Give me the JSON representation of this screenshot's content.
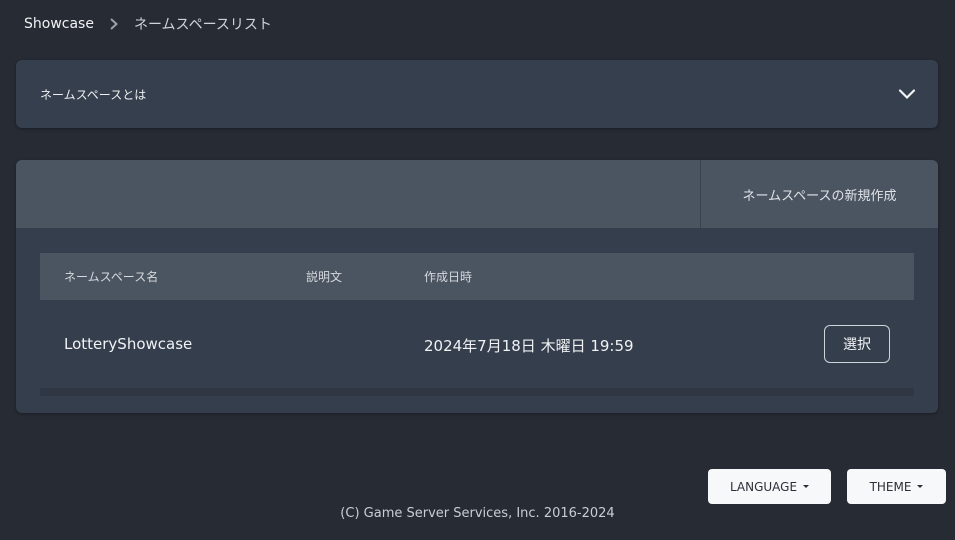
{
  "breadcrumb": {
    "root": "Showcase",
    "current": "ネームスペースリスト"
  },
  "accordion": {
    "title": "ネームスペースとは"
  },
  "toolbar": {
    "create_label": "ネームスペースの新規作成"
  },
  "table": {
    "headers": [
      "ネームスペース名",
      "説明文",
      "作成日時"
    ],
    "rows": [
      {
        "name": "LotteryShowcase",
        "description": "",
        "created_at": "2024年7月18日 木曜日 19:59",
        "action_label": "選択"
      }
    ]
  },
  "buttons": {
    "language": "LANGUAGE",
    "theme": "THEME"
  },
  "footer": {
    "copyright": "(C) Game Server Services, Inc. 2016-2024"
  },
  "colors": {
    "background": "#272b34",
    "card": "#353e4d",
    "header": "#4b5461"
  },
  "icons": {
    "breadcrumb_separator": "chevron-right-icon",
    "accordion_toggle": "chevron-down-icon",
    "dropdown_caret": "caret-down-icon"
  }
}
